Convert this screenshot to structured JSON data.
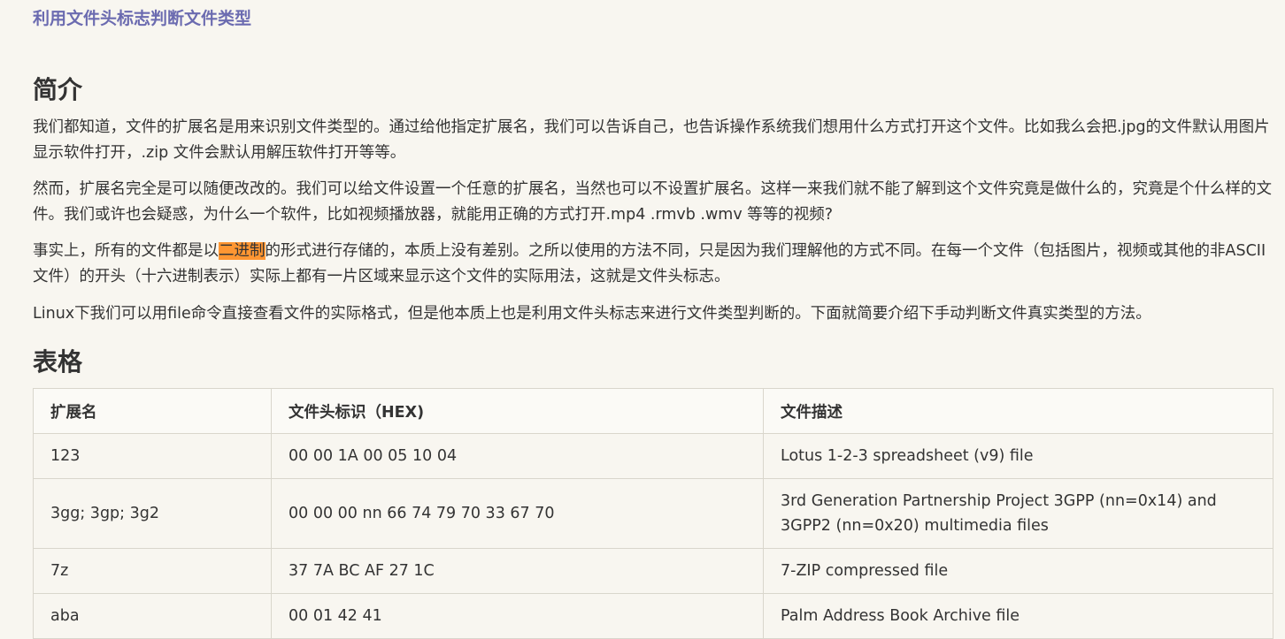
{
  "doc": {
    "title": "利用文件头标志判断文件类型"
  },
  "sections": {
    "intro_heading": "简介",
    "table_heading": "表格"
  },
  "paragraphs": {
    "p1": "我们都知道，文件的扩展名是用来识别文件类型的。通过给他指定扩展名，我们可以告诉自己，也告诉操作系统我们想用什么方式打开这个文件。比如我么会把.jpg的文件默认用图片显示软件打开，.zip 文件会默认用解压软件打开等等。",
    "p2": "然而，扩展名完全是可以随便改改的。我们可以给文件设置一个任意的扩展名，当然也可以不设置扩展名。这样一来我们就不能了解到这个文件究竟是做什么的，究竟是个什么样的文件。我们或许也会疑惑，为什么一个软件，比如视频播放器，就能用正确的方式打开.mp4 .rmvb .wmv 等等的视频?",
    "p3_before": "事实上，所有的文件都是以",
    "p3_highlight": "二进制",
    "p3_after": "的形式进行存储的，本质上没有差别。之所以使用的方法不同，只是因为我们理解他的方式不同。在每一个文件（包括图片，视频或其他的非ASCII文件）的开头（十六进制表示）实际上都有一片区域来显示这个文件的实际用法，这就是文件头标志。",
    "p4": "Linux下我们可以用file命令直接查看文件的实际格式，但是他本质上也是利用文件头标志来进行文件类型判断的。下面就简要介绍下手动判断文件真实类型的方法。"
  },
  "table": {
    "headers": [
      "扩展名",
      "文件头标识（HEX)",
      "文件描述"
    ],
    "rows": [
      [
        "123",
        "00 00 1A 00 05 10 04",
        "Lotus 1-2-3 spreadsheet (v9) file"
      ],
      [
        "3gg; 3gp; 3g2",
        "00 00 00 nn 66 74 79 70 33 67 70",
        "3rd Generation Partnership Project 3GPP (nn=0x14) and 3GPP2 (nn=0x20) multimedia files"
      ],
      [
        "7z",
        "37 7A BC AF 27 1C",
        "7-ZIP compressed file"
      ],
      [
        "aba",
        "00 01 42 41",
        "Palm Address Book Archive file"
      ]
    ]
  },
  "colors": {
    "background": "#f8f6f0",
    "title": "#6b6bb0",
    "highlight": "#ff9632"
  }
}
